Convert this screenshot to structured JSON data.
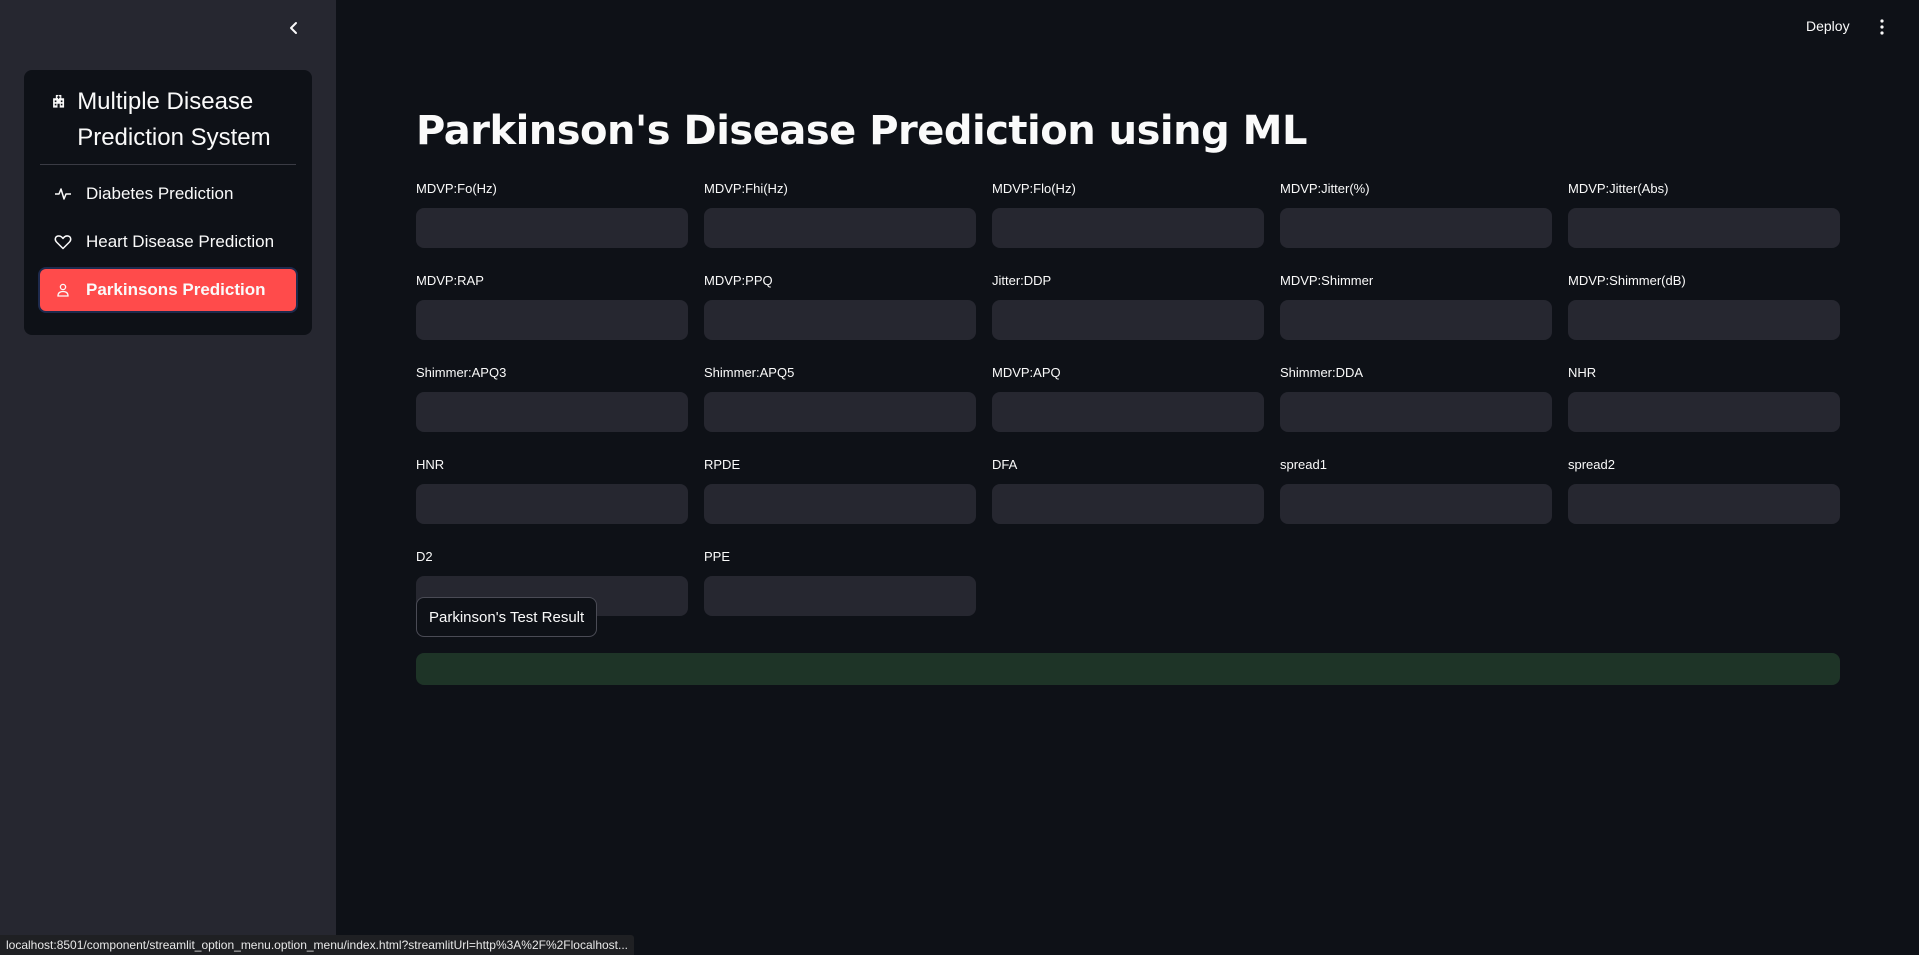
{
  "sidebar": {
    "menu_title": "Multiple Disease Prediction System",
    "items": [
      {
        "label": "Diabetes Prediction",
        "icon": "activity-icon",
        "active": false
      },
      {
        "label": "Heart Disease Prediction",
        "icon": "heart-icon",
        "active": false
      },
      {
        "label": "Parkinsons Prediction",
        "icon": "person-icon",
        "active": true
      }
    ]
  },
  "topbar": {
    "deploy_label": "Deploy"
  },
  "main": {
    "title": "Parkinson's Disease Prediction using ML",
    "fields": [
      "MDVP:Fo(Hz)",
      "MDVP:Fhi(Hz)",
      "MDVP:Flo(Hz)",
      "MDVP:Jitter(%)",
      "MDVP:Jitter(Abs)",
      "MDVP:RAP",
      "MDVP:PPQ",
      "Jitter:DDP",
      "MDVP:Shimmer",
      "MDVP:Shimmer(dB)",
      "Shimmer:APQ3",
      "Shimmer:APQ5",
      "MDVP:APQ",
      "Shimmer:DDA",
      "NHR",
      "HNR",
      "RPDE",
      "DFA",
      "spread1",
      "spread2",
      "D2",
      "PPE"
    ],
    "button_label": "Parkinson's Test Result",
    "result_text": ""
  },
  "statusbar": {
    "url": "localhost:8501/component/streamlit_option_menu.option_menu/index.html?streamlitUrl=http%3A%2F%2Flocalhost..."
  },
  "colors": {
    "accent": "#ff4b4b",
    "background": "#0e1117",
    "sidebar": "#262730",
    "success_bg": "#1e3427"
  }
}
